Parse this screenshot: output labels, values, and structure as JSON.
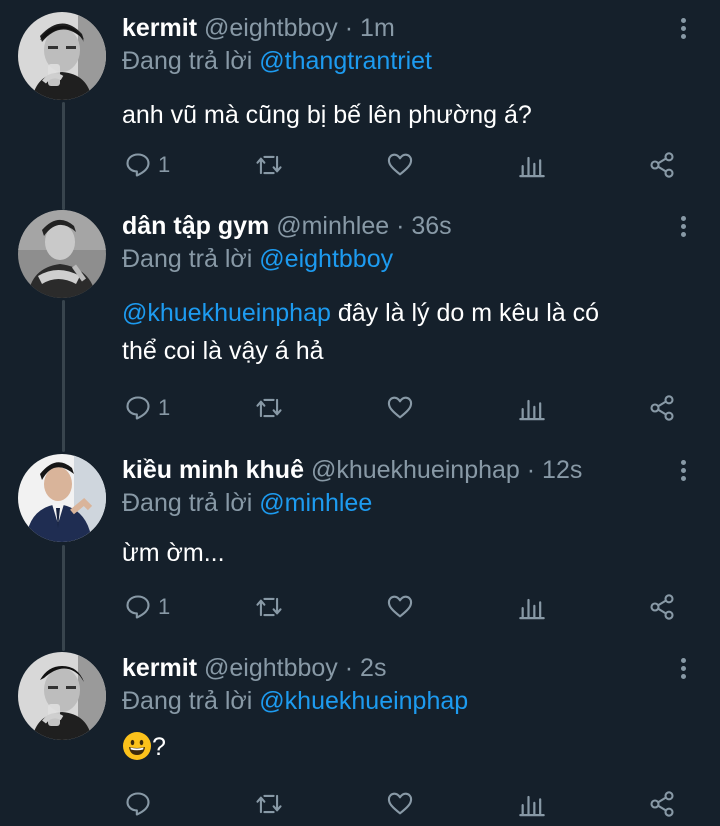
{
  "tweets": [
    {
      "name": "kermit",
      "handle": "@eightbboy",
      "dot": "·",
      "time": "1m",
      "reply_prefix": "Đang trả lời",
      "reply_to": "@thangtrantriet",
      "text": "anh vũ mà cũng bị bế lên phường á?",
      "reply_count": "1"
    },
    {
      "name": "dân tập gym",
      "handle": "@minhlee",
      "dot": "·",
      "time": "36s",
      "reply_prefix": "Đang trả lời",
      "reply_to": "@eightbboy",
      "text_mention": "@khuekhueinphap",
      "text_line1": " đây là lý do m kêu là có",
      "text_line2": "thể coi là vậy á hả",
      "reply_count": "1"
    },
    {
      "name": "kiều minh khuê",
      "handle": "@khuekhueinphap",
      "dot": "·",
      "time": "12s",
      "reply_prefix": "Đang trả lời",
      "reply_to": "@minhlee",
      "text": "ừm ờm...",
      "reply_count": "1"
    },
    {
      "name": "kermit",
      "handle": "@eightbboy",
      "dot": "·",
      "time": "2s",
      "reply_prefix": "Đang trả lời",
      "reply_to": "@khuekhueinphap",
      "text_emoji": "grinning-face-emoji",
      "text": "?",
      "reply_count": ""
    }
  ],
  "icons": {
    "reply": "reply-icon",
    "retweet": "retweet-icon",
    "like": "heart-icon",
    "analytics": "analytics-icon",
    "share": "share-icon",
    "more": "more-vertical-icon"
  },
  "colors": {
    "background": "#15202b",
    "secondary_text": "#8899a6",
    "link": "#1d9bf0",
    "thread_line": "#38444d"
  }
}
